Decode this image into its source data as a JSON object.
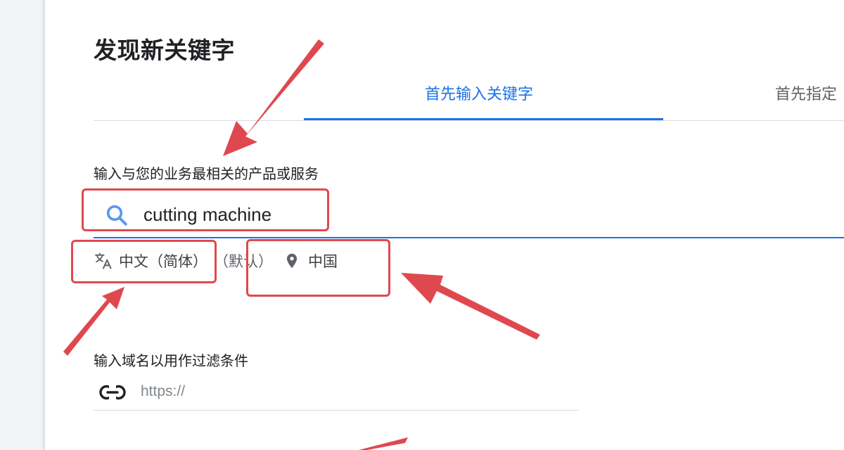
{
  "page": {
    "title": "发现新关键字"
  },
  "tabs": [
    {
      "label": "首先输入关键字",
      "active": true
    },
    {
      "label": "首先指定"
    }
  ],
  "keyword_section": {
    "label": "输入与您的业务最相关的产品或服务",
    "search_value": "cutting machine",
    "language": "中文（简体）",
    "language_default": "（默认）",
    "location": "中国"
  },
  "domain_section": {
    "label": "输入域名以用作过滤条件",
    "url_placeholder": "https://"
  },
  "colors": {
    "accent": "#1a73e8",
    "annotation": "#e0484f",
    "text": "#202124",
    "muted": "#5f6368"
  },
  "icons": {
    "search": "search-icon",
    "translate": "translate-icon",
    "location": "location-pin-icon",
    "link": "link-icon"
  }
}
